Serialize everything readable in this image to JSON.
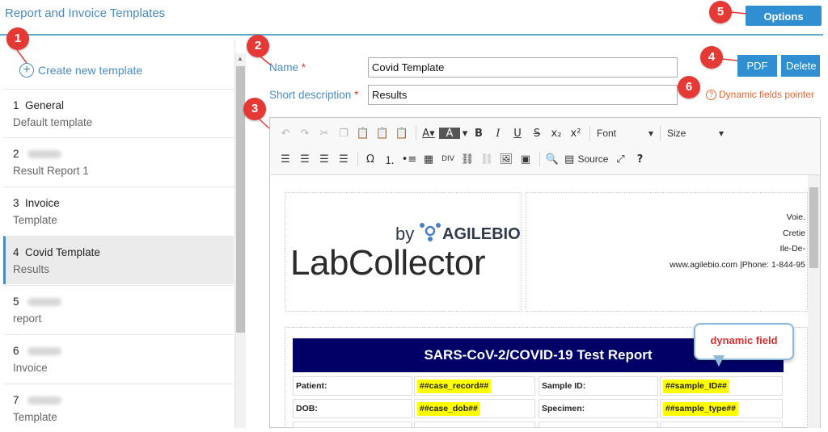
{
  "header": {
    "title": "Report and Invoice Templates",
    "options_label": "Options"
  },
  "callouts": [
    "1",
    "2",
    "3",
    "4",
    "5",
    "6"
  ],
  "sidebar": {
    "create_label": "Create new template",
    "items": [
      {
        "number": "1",
        "name": "General",
        "desc": "Default template"
      },
      {
        "number": "2",
        "name": "",
        "desc": "Result Report 1"
      },
      {
        "number": "3",
        "name": "Invoice",
        "desc": "Template"
      },
      {
        "number": "4",
        "name": "Covid Template",
        "desc": "Results"
      },
      {
        "number": "5",
        "name": "",
        "desc": "report"
      },
      {
        "number": "6",
        "name": "",
        "desc": "Invoice"
      },
      {
        "number": "7",
        "name": "",
        "desc": "Template"
      }
    ]
  },
  "form": {
    "name_label": "Name",
    "name_value": "Covid Template",
    "short_desc_label": "Short description",
    "short_desc_value": "Results",
    "required_mark": "*",
    "pdf_label": "PDF",
    "delete_label": "Delete",
    "dynamic_pointer_label": "Dynamic fields pointer"
  },
  "toolbar": {
    "font_label": "Font",
    "size_label": "Size",
    "source_label": "Source",
    "help_glyph": "?"
  },
  "document": {
    "logo_by": "by",
    "logo_brand": "AGILEBIO",
    "logo_main": "LabCollector",
    "address": [
      "Voie.",
      "Cretie",
      "Ile-De-",
      "www.agilebio.com  |Phone: 1-844-95"
    ],
    "report_title": "SARS-CoV-2/COVID-19 Test Report",
    "rows": [
      {
        "label1": "Patient:",
        "value1": "##case_record##",
        "label2": "Sample ID:",
        "value2": "##sample_ID##"
      },
      {
        "label1": "DOB:",
        "value1": "##case_dob##",
        "label2": "Specimen:",
        "value2": "##sample_type##"
      }
    ]
  },
  "tooltip": {
    "text": "dynamic field"
  },
  "colors": {
    "accent": "#4b8bbe",
    "button": "#2f8fd0",
    "callout": "#e53935",
    "report_header": "#000066",
    "highlight": "#ffff00"
  }
}
